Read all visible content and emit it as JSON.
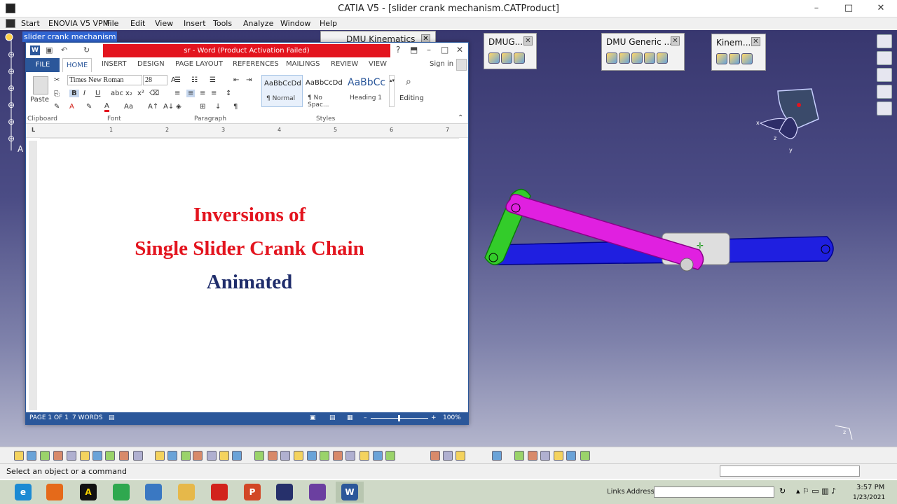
{
  "catia": {
    "title": "CATIA V5 - [slider crank mechanism.CATProduct]",
    "window_controls": {
      "minimize": "–",
      "maximize": "□",
      "close": "✕"
    },
    "menu": [
      "Start",
      "ENOVIA V5 VPM",
      "File",
      "Edit",
      "View",
      "Insert",
      "Tools",
      "Analyze",
      "Window",
      "Help"
    ],
    "tree_root": "slider crank mechanism",
    "tree_marker": "A",
    "toolbars": {
      "dmu_kinematics": "DMU Kinematics",
      "dmug": "DMUG...",
      "dmu_generic": "DMU Generic ...",
      "kinem": "Kinem..."
    },
    "status_text": "Select an object or a command",
    "compass_labels": {
      "x": "x",
      "y": "y",
      "z": "z"
    }
  },
  "word": {
    "title": "sr - Word (Product Activation Failed)",
    "help": "?",
    "sign_in": "Sign in",
    "tabs": [
      "FILE",
      "HOME",
      "INSERT",
      "DESIGN",
      "PAGE LAYOUT",
      "REFERENCES",
      "MAILINGS",
      "REVIEW",
      "VIEW"
    ],
    "ribbon": {
      "paste_label": "Paste",
      "font_name": "Times New Roman",
      "font_size": "28",
      "groups": [
        "Clipboard",
        "Font",
        "Paragraph",
        "Styles"
      ],
      "styles": [
        {
          "sample": "AaBbCcDd",
          "name": "¶ Normal"
        },
        {
          "sample": "AaBbCcDd",
          "name": "¶ No Spac..."
        },
        {
          "sample": "AaBbCc",
          "name": "Heading 1"
        }
      ],
      "editing_label": "Editing"
    },
    "ruler_numbers": [
      "1",
      "2",
      "3",
      "4",
      "5",
      "6",
      "7"
    ],
    "document": {
      "lines": [
        {
          "text": "Inversions of",
          "color": "#e3141e"
        },
        {
          "text": "Single Slider Crank Chain",
          "color": "#e3141e"
        },
        {
          "text": "Animated",
          "color": "#1f2d6b"
        }
      ]
    },
    "status": {
      "page": "PAGE 1 OF 1",
      "words": "7 WORDS",
      "zoom": "100%"
    }
  },
  "taskbar": {
    "apps": [
      {
        "name": "internet-explorer",
        "glyph": "e",
        "color": "#1b8ad3"
      },
      {
        "name": "firefox",
        "glyph": "",
        "color": "#e56a1a"
      },
      {
        "name": "autocad",
        "glyph": "A",
        "color": "#111111"
      },
      {
        "name": "chrome",
        "glyph": "",
        "color": "#2fa84f"
      },
      {
        "name": "this-pc",
        "glyph": "",
        "color": "#3a78c2"
      },
      {
        "name": "file-explorer",
        "glyph": "",
        "color": "#e6b84a"
      },
      {
        "name": "acrobat",
        "glyph": "",
        "color": "#d2231c"
      },
      {
        "name": "powerpoint",
        "glyph": "P",
        "color": "#d24726"
      },
      {
        "name": "catia",
        "glyph": "",
        "color": "#26306b"
      },
      {
        "name": "meeting",
        "glyph": "",
        "color": "#6b3fa0"
      },
      {
        "name": "word",
        "glyph": "W",
        "color": "#2b579a"
      }
    ],
    "links": "Links",
    "address_label": "Address",
    "time": "3:57 PM",
    "date": "1/23/2021"
  },
  "colors": {
    "crank": "#33cc2a",
    "connecting_rod": "#e020e0",
    "frame": "#1f1fe0",
    "slider": "#dedede"
  }
}
